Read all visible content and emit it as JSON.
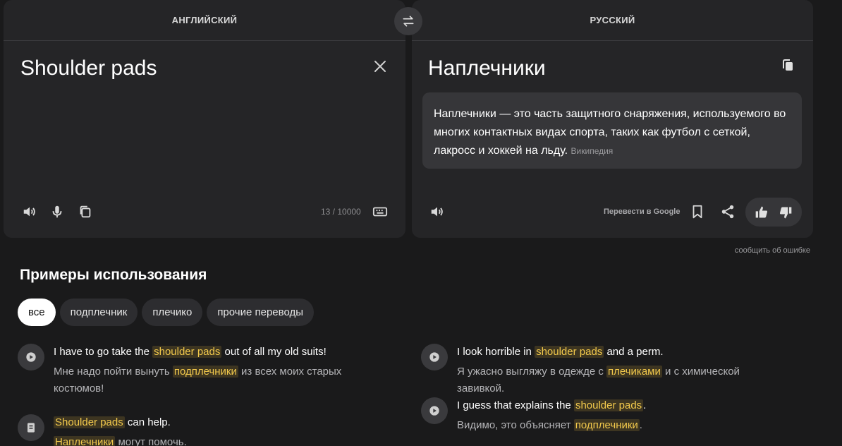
{
  "source": {
    "language": "АНГЛИЙСКИЙ",
    "text": "Shoulder pads",
    "counter": "13 / 10000"
  },
  "target": {
    "language": "РУССКИЙ",
    "text": "Наплечники",
    "wiki_text": "Наплечники — это часть защитного снаряжения, используемого во многих контактных видах спорта, таких как футбол с сеткой, лакросс и хоккей на льду.",
    "wiki_source": "Википедия",
    "google_label": "Перевести в Google"
  },
  "report_label": "сообщить об ошибке",
  "examples": {
    "title": "Примеры использования",
    "chips": [
      "все",
      "подплечник",
      "плечико",
      "прочие переводы"
    ],
    "items": [
      {
        "en_before": "I have to go take the ",
        "en_hl": "shoulder pads",
        "en_after": " out of all my old suits!",
        "ru_before": "Мне надо пойти вынуть ",
        "ru_hl": "подплечники",
        "ru_after": " из всех моих старых",
        "ru_line2": "костюмов!",
        "icon": "play-icon"
      },
      {
        "en_before": "",
        "en_hl": "Shoulder pads",
        "en_after": " can help.",
        "ru_before": "",
        "ru_hl": "Наплечники",
        "ru_after": " могут помочь.",
        "icon": "book-icon"
      },
      {
        "en_before": "I look horrible in ",
        "en_hl": "shoulder pads",
        "en_after": " and a perm.",
        "ru_before": "Я ужасно выгляжу в одежде с ",
        "ru_hl": "плечиками",
        "ru_after": " и с химической завивкой.",
        "icon": "play-icon"
      },
      {
        "en_before": "I guess that explains the ",
        "en_hl": "shoulder pads",
        "en_after": ".",
        "ru_before": "Видимо, это объясняет ",
        "ru_hl": "подплечники",
        "ru_after": ".",
        "icon": "play-icon"
      }
    ]
  },
  "colors": {
    "background": "#1a1a1b",
    "panel": "#252527",
    "highlight_text": "#f2c94c",
    "highlight_bg": "#3d3521"
  }
}
